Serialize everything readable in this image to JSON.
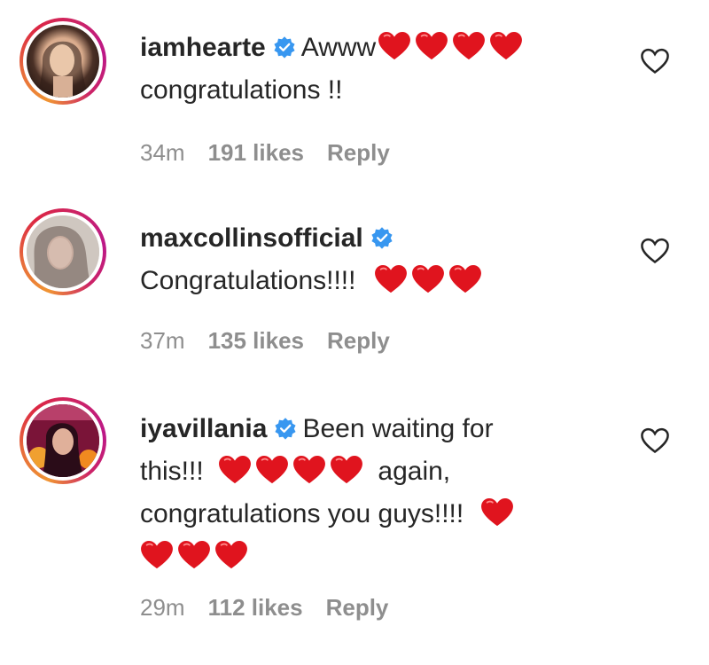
{
  "comments": [
    {
      "username": "iamhearte",
      "verified": true,
      "text_before": "Awww",
      "hearts_inline": 4,
      "text_lines": [
        "congratulations !!"
      ],
      "time": "34m",
      "likes": "191 likes",
      "reply": "Reply"
    },
    {
      "username": "maxcollinsofficial",
      "verified": true,
      "text_main": "Congratulations!!!!",
      "hearts_inline": 3,
      "time": "37m",
      "likes": "135 likes",
      "reply": "Reply"
    },
    {
      "username": "iyavillania",
      "verified": true,
      "text_first": "Been waiting for",
      "text_second_a": "this!!!",
      "hearts_mid": 4,
      "text_second_b": "again,",
      "text_third": "congratulations you guys!!!!",
      "hearts_end_a": 1,
      "hearts_end_b": 3,
      "time": "29m",
      "likes": "112 likes",
      "reply": "Reply"
    }
  ],
  "icons": {
    "verified": "verified-badge-icon",
    "heart_emoji": "red-heart-emoji",
    "like": "heart-outline-icon"
  },
  "colors": {
    "verified_blue": "#3897f0",
    "heart_red": "#e0141e",
    "meta_gray": "#8e8e8e",
    "text": "#262626"
  }
}
